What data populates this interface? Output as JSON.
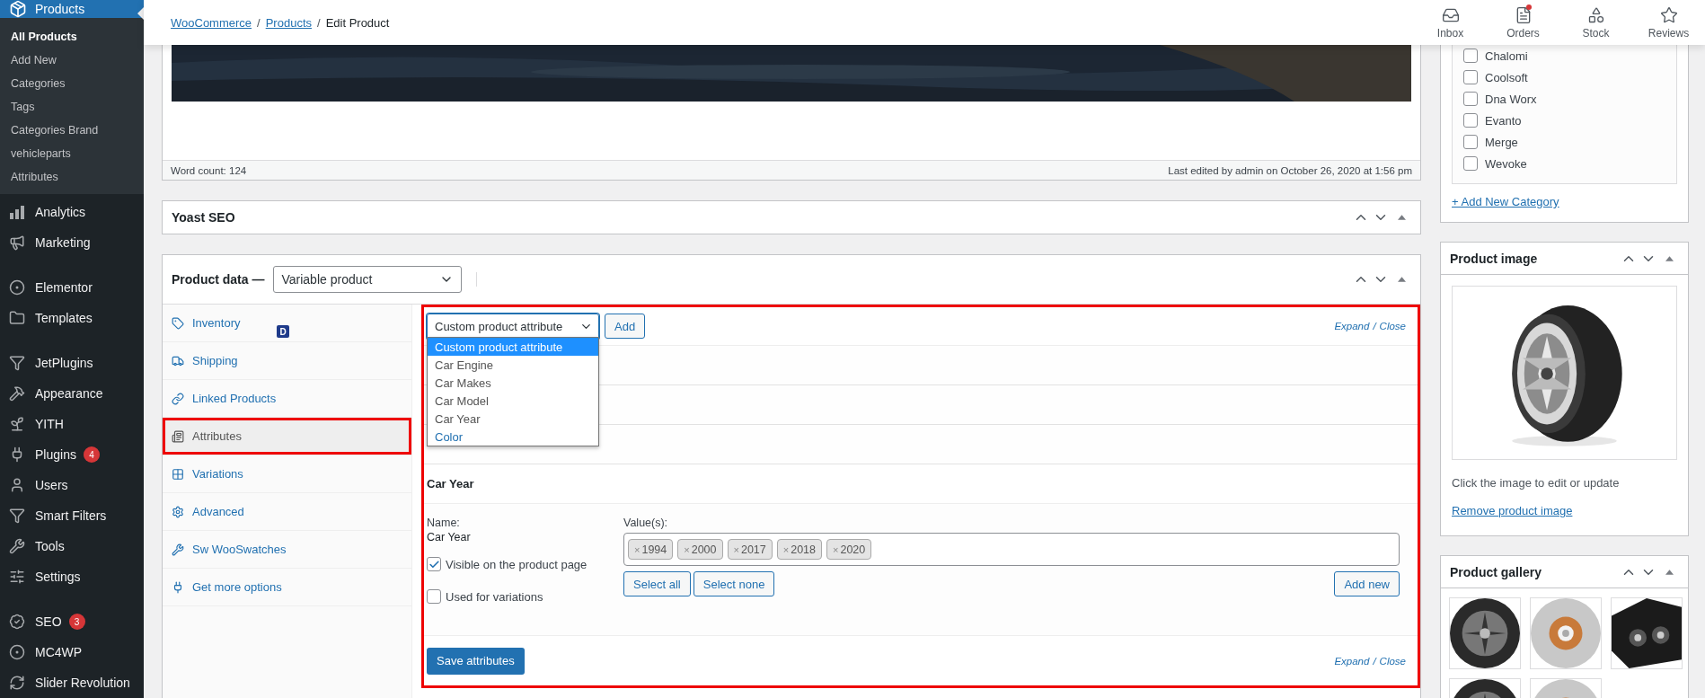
{
  "sidebar": {
    "header": {
      "label": "Products",
      "selected": true
    },
    "submenu": [
      {
        "label": "All Products",
        "selected": true
      },
      {
        "label": "Add New",
        "selected": false
      },
      {
        "label": "Categories",
        "selected": false
      },
      {
        "label": "Tags",
        "selected": false
      },
      {
        "label": "Categories Brand",
        "selected": false
      },
      {
        "label": "vehicleparts",
        "selected": false
      },
      {
        "label": "Attributes",
        "selected": false
      }
    ],
    "groups": [
      [
        {
          "label": "Analytics"
        },
        {
          "label": "Marketing"
        }
      ],
      [
        {
          "label": "Elementor"
        },
        {
          "label": "Templates"
        }
      ],
      [
        {
          "label": "JetPlugins"
        },
        {
          "label": "Appearance"
        },
        {
          "label": "YITH"
        },
        {
          "label": "Plugins",
          "count": "4"
        },
        {
          "label": "Users"
        },
        {
          "label": "Smart Filters"
        },
        {
          "label": "Tools"
        },
        {
          "label": "Settings"
        }
      ],
      [
        {
          "label": "SEO",
          "count": "3"
        },
        {
          "label": "MC4WP"
        },
        {
          "label": "Slider Revolution"
        }
      ]
    ]
  },
  "topbar": {
    "breadcrumb": [
      {
        "label": "WooCommerce",
        "link": true
      },
      {
        "label": "Products",
        "link": true
      },
      {
        "label": "Edit Product",
        "link": false
      }
    ],
    "separator": "/",
    "activity": [
      {
        "label": "Inbox",
        "unread": false
      },
      {
        "label": "Orders",
        "unread": true
      },
      {
        "label": "Stock",
        "unread": false
      },
      {
        "label": "Reviews",
        "unread": false
      }
    ]
  },
  "editor": {
    "word_count": "Word count: 124",
    "last_edited": "Last edited by admin on October 26, 2020 at 1:56 pm"
  },
  "yoast": {
    "title": "Yoast SEO"
  },
  "product_data": {
    "title": "Product data —",
    "type": "Variable product",
    "tabs": [
      {
        "label": "Inventory",
        "selected": false,
        "badge": "D"
      },
      {
        "label": "Shipping",
        "selected": false
      },
      {
        "label": "Linked Products",
        "selected": false
      },
      {
        "label": "Attributes",
        "selected": true,
        "highlighted": true
      },
      {
        "label": "Variations",
        "selected": false
      },
      {
        "label": "Advanced",
        "selected": false
      },
      {
        "label": "Sw WooSwatches",
        "selected": false
      },
      {
        "label": "Get more options",
        "selected": false
      }
    ],
    "panel": {
      "highlighted": true,
      "attribute_select": {
        "value": "Custom product attribute",
        "expanded": true,
        "options": [
          {
            "label": "Custom product attribute",
            "selected": true
          },
          {
            "label": "Car Engine",
            "selected": false
          },
          {
            "label": "Car Makes",
            "selected": false
          },
          {
            "label": "Car Model",
            "selected": false
          },
          {
            "label": "Car Year",
            "selected": false
          },
          {
            "label": "Color",
            "selected": false
          }
        ]
      },
      "add_button": "Add",
      "top_links": {
        "expand": "Expand",
        "separator": "/",
        "close": "Close"
      },
      "attributes": [
        {
          "expanded": false
        },
        {
          "expanded": false
        },
        {
          "expanded": false
        },
        {
          "name": "Car Year",
          "expanded": true,
          "details": {
            "name_label": "Name:",
            "name_value": "Car Year",
            "values_label": "Value(s):",
            "remove": "×",
            "values": [
              "1994",
              "2000",
              "2017",
              "2018",
              "2020"
            ],
            "checkboxes": [
              {
                "label": "Visible on the product page",
                "checked": true
              },
              {
                "label": "Used for variations",
                "checked": false
              }
            ],
            "select_all": "Select all",
            "select_none": "Select none",
            "add_new": "Add new"
          }
        }
      ],
      "save_button": "Save attributes",
      "bottom_links": {
        "expand": "Expand",
        "separator": "/",
        "close": "Close"
      }
    }
  },
  "categories": {
    "items": [
      {
        "label": "Chalomi",
        "checked": false
      },
      {
        "label": "Coolsoft",
        "checked": false
      },
      {
        "label": "Dna Worx",
        "checked": false
      },
      {
        "label": "Evanto",
        "checked": false
      },
      {
        "label": "Merge",
        "checked": false
      },
      {
        "label": "Wevoke",
        "checked": false
      }
    ],
    "add_link": "+ Add New Category"
  },
  "product_image": {
    "title": "Product image",
    "caption": "Click the image to edit or update",
    "remove_link": "Remove product image"
  },
  "product_gallery": {
    "title": "Product gallery"
  }
}
